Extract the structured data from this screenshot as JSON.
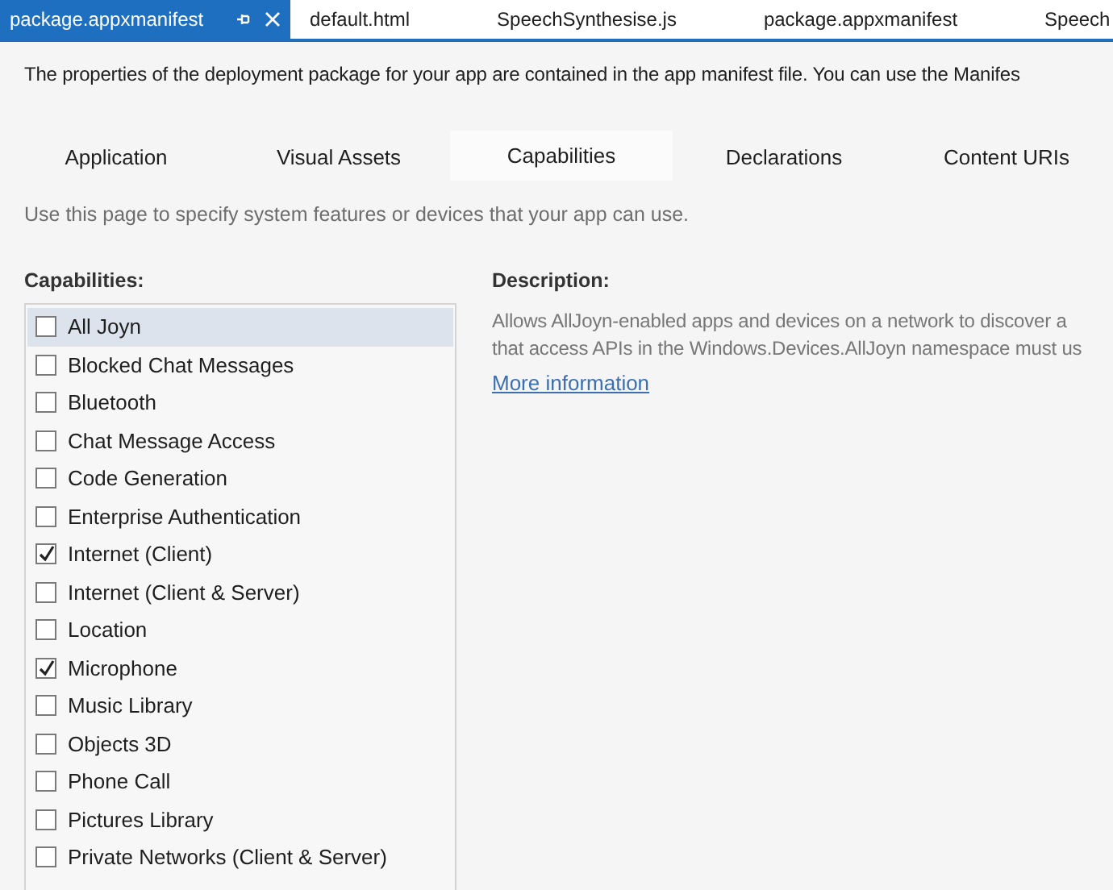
{
  "document_tabs": [
    {
      "label": "package.appxmanifest",
      "selected": true
    },
    {
      "label": "default.html",
      "selected": false
    },
    {
      "label": "SpeechSynthesise.js",
      "selected": false
    },
    {
      "label": "package.appxmanifest",
      "selected": false
    },
    {
      "label": "Speech",
      "selected": false
    }
  ],
  "intro": "The properties of the deployment package for your app are contained in the app manifest file. You can use the Manifes",
  "page_tabs": [
    {
      "label": "Application",
      "selected": false
    },
    {
      "label": "Visual Assets",
      "selected": false
    },
    {
      "label": "Capabilities",
      "selected": true
    },
    {
      "label": "Declarations",
      "selected": false
    },
    {
      "label": "Content URIs",
      "selected": false
    }
  ],
  "hint": "Use this page to specify system features or devices that your app can use.",
  "capabilities": {
    "heading": "Capabilities:",
    "items": [
      {
        "label": "All Joyn",
        "checked": false,
        "selected": true
      },
      {
        "label": "Blocked Chat Messages",
        "checked": false,
        "selected": false
      },
      {
        "label": "Bluetooth",
        "checked": false,
        "selected": false
      },
      {
        "label": "Chat Message Access",
        "checked": false,
        "selected": false
      },
      {
        "label": "Code Generation",
        "checked": false,
        "selected": false
      },
      {
        "label": "Enterprise Authentication",
        "checked": false,
        "selected": false
      },
      {
        "label": "Internet (Client)",
        "checked": true,
        "selected": false
      },
      {
        "label": "Internet (Client & Server)",
        "checked": false,
        "selected": false
      },
      {
        "label": "Location",
        "checked": false,
        "selected": false
      },
      {
        "label": "Microphone",
        "checked": true,
        "selected": false
      },
      {
        "label": "Music Library",
        "checked": false,
        "selected": false
      },
      {
        "label": "Objects 3D",
        "checked": false,
        "selected": false
      },
      {
        "label": "Phone Call",
        "checked": false,
        "selected": false
      },
      {
        "label": "Pictures Library",
        "checked": false,
        "selected": false
      },
      {
        "label": "Private Networks (Client & Server)",
        "checked": false,
        "selected": false
      }
    ]
  },
  "description": {
    "heading": "Description:",
    "lines": [
      "Allows AllJoyn-enabled apps and devices on a network to discover a",
      "that access APIs in the Windows.Devices.AllJoyn namespace must us"
    ],
    "link": "More information"
  }
}
